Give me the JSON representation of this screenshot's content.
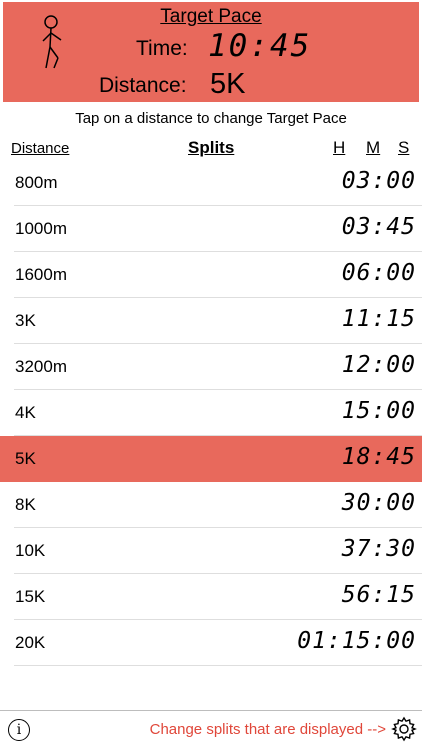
{
  "header": {
    "title": "Target Pace",
    "time_label": "Time:",
    "time_value": "10:45",
    "distance_label": "Distance:",
    "distance_value": "5K",
    "accent_color": "#e8695c"
  },
  "hint": "Tap on a distance to change Target Pace",
  "columns": {
    "distance": "Distance",
    "splits": "Splits",
    "h": "H",
    "m": "M",
    "s": "S"
  },
  "splits": [
    {
      "distance": "800m",
      "split": "03:00"
    },
    {
      "distance": "1000m",
      "split": "03:45"
    },
    {
      "distance": "1600m",
      "split": "06:00"
    },
    {
      "distance": "3K",
      "split": "11:15"
    },
    {
      "distance": "3200m",
      "split": "12:00"
    },
    {
      "distance": "4K",
      "split": "15:00"
    },
    {
      "distance": "5K",
      "split": "18:45",
      "selected": true
    },
    {
      "distance": "8K",
      "split": "30:00"
    },
    {
      "distance": "10K",
      "split": "37:30"
    },
    {
      "distance": "15K",
      "split": "56:15"
    },
    {
      "distance": "20K",
      "split": "01:15:00"
    }
  ],
  "footer": {
    "info_icon": "info-icon",
    "change_link": "Change splits that are displayed -->",
    "link_color": "#e0473a",
    "settings_icon": "gear-icon"
  }
}
